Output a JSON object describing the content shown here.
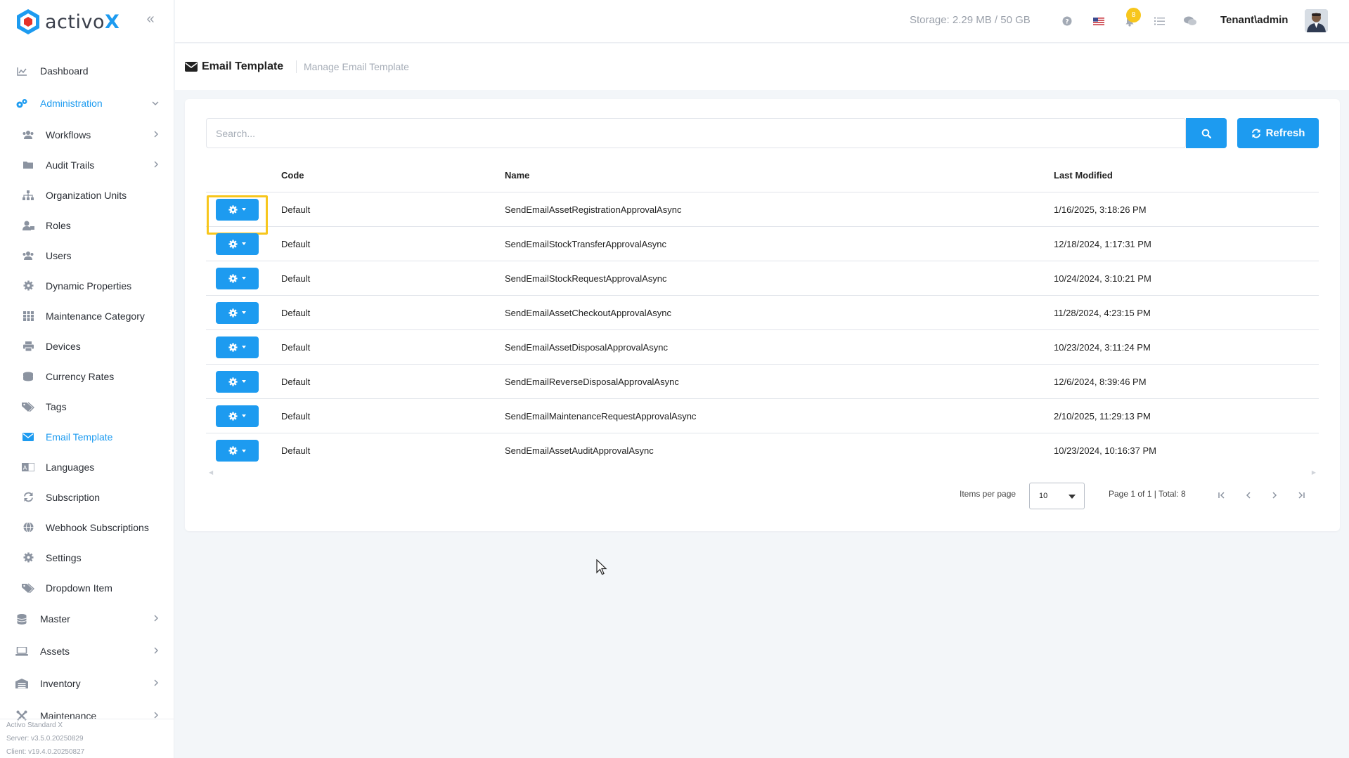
{
  "app": {
    "logo_prefix": "activo",
    "logo_suffix": "X",
    "version_lines": [
      "Activo Standard X",
      "Server: v3.5.0.20250829",
      "Client: v19.4.0.20250827"
    ]
  },
  "sidebar": {
    "items": [
      {
        "label": "Dashboard",
        "icon": "chart-line-icon",
        "level": "top"
      },
      {
        "label": "Administration",
        "icon": "gears-icon",
        "level": "top",
        "active": true,
        "expanded": true
      },
      {
        "label": "Workflows",
        "icon": "users-icon",
        "level": "sub",
        "chevron": true
      },
      {
        "label": "Audit Trails",
        "icon": "folder-icon",
        "level": "sub",
        "chevron": true
      },
      {
        "label": "Organization Units",
        "icon": "sitemap-icon",
        "level": "sub"
      },
      {
        "label": "Roles",
        "icon": "user-tag-icon",
        "level": "sub"
      },
      {
        "label": "Users",
        "icon": "users-icon",
        "level": "sub"
      },
      {
        "label": "Dynamic Properties",
        "icon": "cog-icon",
        "level": "sub"
      },
      {
        "label": "Maintenance Category",
        "icon": "grid-icon",
        "level": "sub"
      },
      {
        "label": "Devices",
        "icon": "printer-icon",
        "level": "sub"
      },
      {
        "label": "Currency Rates",
        "icon": "coins-icon",
        "level": "sub"
      },
      {
        "label": "Tags",
        "icon": "tags-icon",
        "level": "sub"
      },
      {
        "label": "Email Template",
        "icon": "envelope-icon",
        "level": "sub",
        "active": true
      },
      {
        "label": "Languages",
        "icon": "language-icon",
        "level": "sub"
      },
      {
        "label": "Subscription",
        "icon": "sync-icon",
        "level": "sub"
      },
      {
        "label": "Webhook Subscriptions",
        "icon": "globe-icon",
        "level": "sub"
      },
      {
        "label": "Settings",
        "icon": "cog-icon",
        "level": "sub"
      },
      {
        "label": "Dropdown Item",
        "icon": "tags-icon",
        "level": "sub"
      },
      {
        "label": "Master",
        "icon": "database-icon",
        "level": "top",
        "chevron": true
      },
      {
        "label": "Assets",
        "icon": "laptop-icon",
        "level": "top",
        "chevron": true
      },
      {
        "label": "Inventory",
        "icon": "warehouse-icon",
        "level": "top",
        "chevron": true
      },
      {
        "label": "Maintenance",
        "icon": "tools-icon",
        "level": "top",
        "chevron": true
      }
    ]
  },
  "header": {
    "storage": "Storage: 2.29 MB / 50 GB",
    "notification_count": "8",
    "user": "Tenant\\admin"
  },
  "page": {
    "title": "Email Template",
    "subtitle": "Manage Email Template"
  },
  "search": {
    "placeholder": "Search...",
    "refresh_label": "Refresh"
  },
  "table": {
    "headers": {
      "code": "Code",
      "name": "Name",
      "modified": "Last Modified"
    },
    "rows": [
      {
        "code": "Default",
        "name": "SendEmailAssetRegistrationApprovalAsync",
        "modified": "1/16/2025, 3:18:26 PM"
      },
      {
        "code": "Default",
        "name": "SendEmailStockTransferApprovalAsync",
        "modified": "12/18/2024, 1:17:31 PM"
      },
      {
        "code": "Default",
        "name": "SendEmailStockRequestApprovalAsync",
        "modified": "10/24/2024, 3:10:21 PM"
      },
      {
        "code": "Default",
        "name": "SendEmailAssetCheckoutApprovalAsync",
        "modified": "11/28/2024, 4:23:15 PM"
      },
      {
        "code": "Default",
        "name": "SendEmailAssetDisposalApprovalAsync",
        "modified": "10/23/2024, 3:11:24 PM"
      },
      {
        "code": "Default",
        "name": "SendEmailReverseDisposalApprovalAsync",
        "modified": "12/6/2024, 8:39:46 PM"
      },
      {
        "code": "Default",
        "name": "SendEmailMaintenanceRequestApprovalAsync",
        "modified": "2/10/2025, 11:29:13 PM"
      },
      {
        "code": "Default",
        "name": "SendEmailAssetAuditApprovalAsync",
        "modified": "10/23/2024, 10:16:37 PM"
      }
    ]
  },
  "pagination": {
    "items_per_page_label": "Items per page",
    "items_per_page": "10",
    "page_info": "Page 1 of 1 | Total: 8"
  },
  "colors": {
    "accent": "#1d9bf0",
    "highlight": "#f7c61c"
  }
}
